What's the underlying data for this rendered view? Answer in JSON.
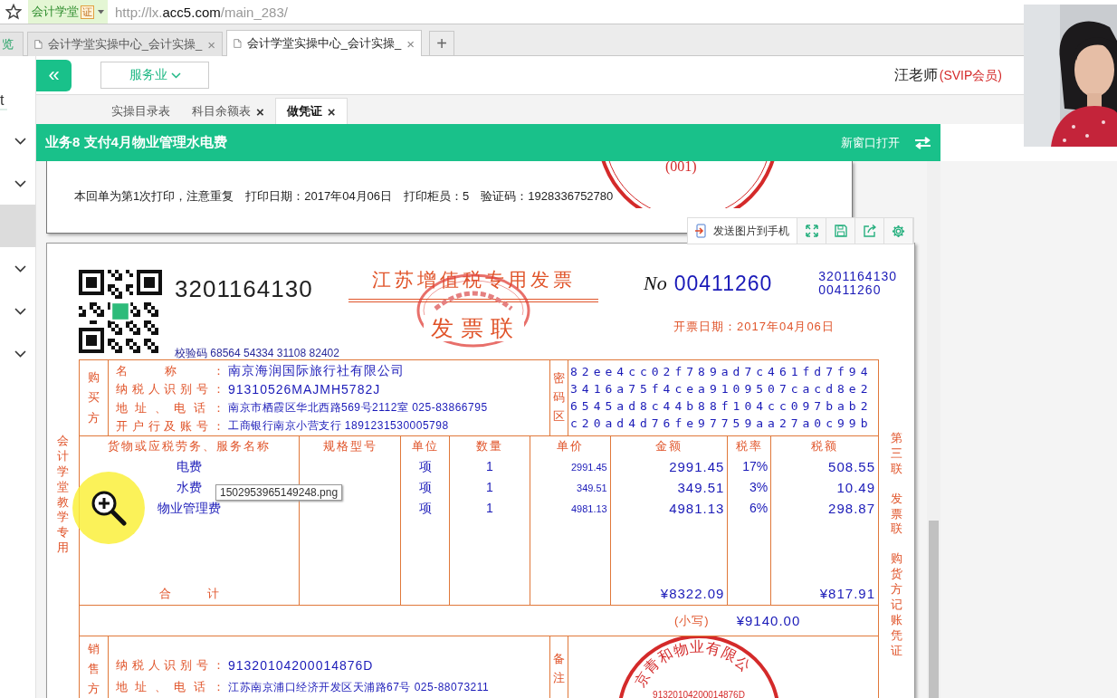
{
  "browser": {
    "site": "会计学堂",
    "site_mark": "证",
    "url_scheme": "http://lx.",
    "url_host": "acc5.com",
    "url_path": "/main_283/",
    "tabs": [
      {
        "label": "览",
        "selected": false,
        "icon": false
      },
      {
        "label": "会计学堂实操中心_会计实操_",
        "selected": false,
        "icon": true,
        "close": "×"
      },
      {
        "label": "会计学堂实操中心_会计实操_",
        "selected": true,
        "icon": true,
        "close": "×"
      }
    ],
    "new_tab": "+"
  },
  "sidebar": {
    "title": "t",
    "items": [
      {
        "selected": false,
        "expandable": true
      },
      {
        "selected": false,
        "expandable": true
      },
      {
        "selected": true,
        "expandable": false
      },
      {
        "selected": false,
        "expandable": true
      },
      {
        "selected": false,
        "expandable": true
      },
      {
        "selected": false,
        "expandable": true
      }
    ]
  },
  "header": {
    "collapse": "«",
    "industry": "服务业",
    "user": "汪老师",
    "membership": "(SVIP会员)"
  },
  "page_tabs": [
    {
      "label": "实操目录表",
      "selected": false
    },
    {
      "label": "科目余额表",
      "selected": false,
      "close": "×"
    },
    {
      "label": "做凭证",
      "selected": true,
      "close": "×"
    }
  ],
  "task_bar": {
    "title": "业务8 支付4月物业管理水电费",
    "open_new": "新窗口打开"
  },
  "receipt": {
    "note": "本回单为第1次打印，注意重复　打印日期：2017年04月06日　打印柜员：5　验证码：1928336752780",
    "stamp": "(001)"
  },
  "image_toolbar": {
    "send": "发送图片到手机"
  },
  "invoice": {
    "code": "3201164130",
    "title": "江苏增值税专用发票",
    "copy": "发票联",
    "no_label": "No",
    "number": "00411260",
    "code_small": "3201164130",
    "number_small": "00411260",
    "date_label": "开票日期：",
    "date": "2017年04月06日",
    "check_label": "校验码",
    "check": "68564 54334 31108 82402",
    "left_margin": "会计学堂教学专用",
    "right_margin": [
      "第三联",
      "发票联",
      "购货方记账凭证"
    ],
    "buyer": {
      "label": "购买方",
      "rows": [
        {
          "label": "名称：",
          "value": "南京海润国际旅行社有限公司"
        },
        {
          "label": "纳税人识别号：",
          "value": "91310526MAJMH5782J"
        },
        {
          "label": "地址、电话：",
          "value": "南京市栖霞区华北西路569号2112室 025-83866795"
        },
        {
          "label": "开户行及账号：",
          "value": "工商银行南京小营支行 1891231530005798"
        }
      ]
    },
    "cipher_label": "密码区",
    "cipher": [
      "82ee4cc02f789ad7c461fd7f94",
      "3416a75f4cea9109507cacd8e2",
      "6545ad8c44b88f104cc097bab2",
      "c20ad4d76fe97759aa27a0c99b"
    ],
    "columns": [
      "货物或应税劳务、服务名称",
      "规格型号",
      "单位",
      "数量",
      "单价",
      "金额",
      "税率",
      "税额"
    ],
    "items": [
      {
        "name": "电费",
        "unit": "项",
        "quantity": "1",
        "price": "2991.45",
        "amount": "2991.45",
        "rate": "17%",
        "tax": "508.55"
      },
      {
        "name": "水费",
        "unit": "项",
        "quantity": "1",
        "price": "349.51",
        "amount": "349.51",
        "rate": "3%",
        "tax": "10.49"
      },
      {
        "name": "物业管理费",
        "unit": "项",
        "quantity": "1",
        "price": "4981.13",
        "amount": "4981.13",
        "rate": "6%",
        "tax": "298.87"
      }
    ],
    "total_label": "合计",
    "total_amount": "¥8322.09",
    "total_tax": "¥817.91",
    "grand_small_label": "(小写)",
    "grand_total": "¥9140.00",
    "seller": {
      "label": "销售方",
      "rows": [
        {
          "label": "纳税人识别号：",
          "value": "91320104200014876D"
        },
        {
          "label": "地址、电话：",
          "value": "江苏南京浦口经济开发区天浦路67号 025-88073211"
        }
      ]
    },
    "remarks_label": "备注",
    "seller_stamp": {
      "name": "京青和物业有限公",
      "tax_id": "91320104200014876D"
    }
  },
  "tooltip": "1502953965149248.png"
}
